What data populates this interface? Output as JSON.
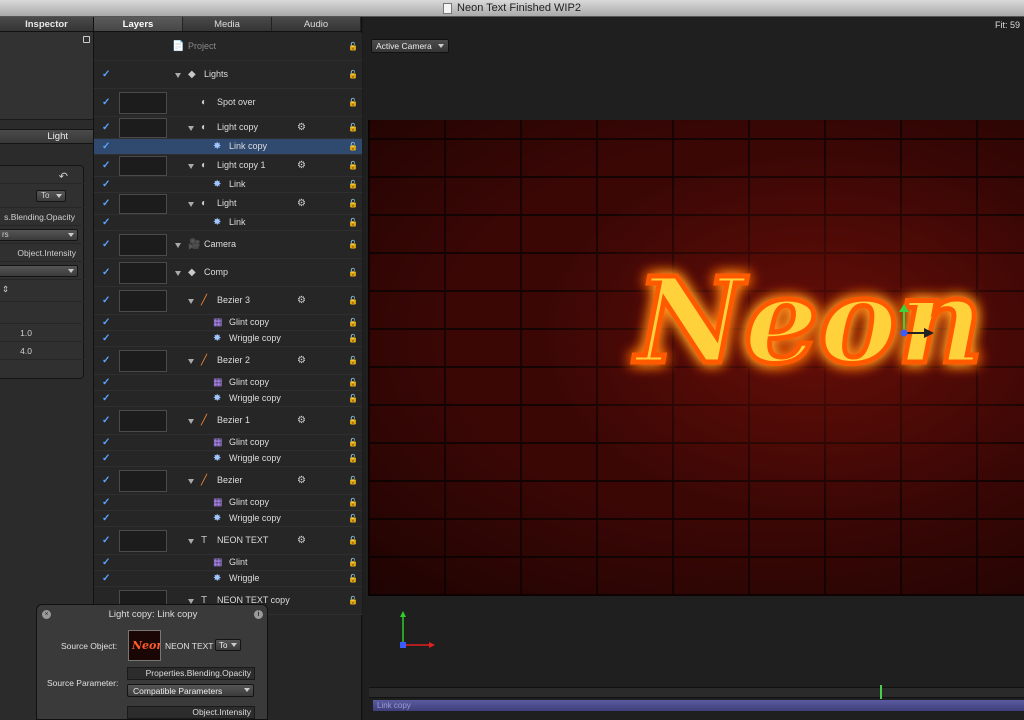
{
  "window": {
    "title": "Neon Text Finished WIP2"
  },
  "inspector": {
    "tab": "Inspector",
    "section_tab": "Light",
    "rows": {
      "to_value": "To",
      "source_parameter": "s.Blending.Opacity",
      "compatible": "rs",
      "target_parameter": "Object.Intensity",
      "stepper": "⇕",
      "val1": "1.0",
      "val2": "4.0"
    }
  },
  "layers_panel": {
    "tabs": [
      "Layers",
      "Media",
      "Audio"
    ],
    "rows": [
      {
        "label": "Project",
        "icon": "📄",
        "checked": false,
        "thumb": false,
        "indent": 94
      },
      {
        "label": "Lights",
        "icon": "◆",
        "checked": true,
        "thumb": false,
        "indent": 110
      },
      {
        "label": "Spot over",
        "icon": "◐",
        "checked": true,
        "thumb": true,
        "indent": 123
      },
      {
        "label": "Light copy",
        "icon": "◐",
        "checked": true,
        "thumb": true,
        "indent": 123
      },
      {
        "label": "Link copy",
        "icon": "✸",
        "checked": true,
        "thumb": false,
        "indent": 135
      },
      {
        "label": "Light copy 1",
        "icon": "◐",
        "checked": true,
        "thumb": true,
        "indent": 123
      },
      {
        "label": "Link",
        "icon": "✸",
        "checked": true,
        "thumb": false,
        "indent": 135
      },
      {
        "label": "Light",
        "icon": "◐",
        "checked": true,
        "thumb": true,
        "indent": 123
      },
      {
        "label": "Link",
        "icon": "✸",
        "checked": true,
        "thumb": false,
        "indent": 135
      },
      {
        "label": "Camera",
        "icon": "🎥",
        "checked": true,
        "thumb": true,
        "indent": 110
      },
      {
        "label": "Comp",
        "icon": "◆",
        "checked": true,
        "thumb": true,
        "indent": 110
      },
      {
        "label": "Bezier 3",
        "icon": "╱",
        "checked": true,
        "thumb": true,
        "indent": 123
      },
      {
        "label": "Glint copy",
        "icon": "▦",
        "checked": true,
        "thumb": false,
        "indent": 135
      },
      {
        "label": "Wriggle copy",
        "icon": "✸",
        "checked": true,
        "thumb": false,
        "indent": 135
      },
      {
        "label": "Bezier 2",
        "icon": "╱",
        "checked": true,
        "thumb": true,
        "indent": 123
      },
      {
        "label": "Glint copy",
        "icon": "▦",
        "checked": true,
        "thumb": false,
        "indent": 135
      },
      {
        "label": "Wriggle copy",
        "icon": "✸",
        "checked": true,
        "thumb": false,
        "indent": 135
      },
      {
        "label": "Bezier 1",
        "icon": "╱",
        "checked": true,
        "thumb": true,
        "indent": 123
      },
      {
        "label": "Glint copy",
        "icon": "▦",
        "checked": true,
        "thumb": false,
        "indent": 135
      },
      {
        "label": "Wriggle copy",
        "icon": "✸",
        "checked": true,
        "thumb": false,
        "indent": 135
      },
      {
        "label": "Bezier",
        "icon": "╱",
        "checked": true,
        "thumb": true,
        "indent": 123
      },
      {
        "label": "Glint copy",
        "icon": "▦",
        "checked": true,
        "thumb": false,
        "indent": 135
      },
      {
        "label": "Wriggle copy",
        "icon": "✸",
        "checked": true,
        "thumb": false,
        "indent": 135
      },
      {
        "label": "NEON TEXT",
        "icon": "T",
        "checked": true,
        "thumb": true,
        "indent": 123
      },
      {
        "label": "Glint",
        "icon": "▦",
        "checked": true,
        "thumb": false,
        "indent": 135
      },
      {
        "label": "Wriggle",
        "icon": "✸",
        "checked": true,
        "thumb": false,
        "indent": 135
      },
      {
        "label": "NEON TEXT copy",
        "icon": "T",
        "checked": false,
        "thumb": true,
        "indent": 123
      }
    ]
  },
  "canvas": {
    "fit_label": "Fit: 59",
    "camera_menu": "Active Camera",
    "neon_text": "Neon",
    "clip_label": "Link copy"
  },
  "hud": {
    "title": "Light copy: Link copy",
    "source_object_label": "Source Object:",
    "source_object_value": "NEON TEXT",
    "to_value": "To",
    "source_parameter_label": "Source Parameter:",
    "source_parameter_value": "Properties.Blending.Opacity",
    "compatible_menu": "Compatible Parameters",
    "target_value": "Object.Intensity",
    "thumb_text": "Neon"
  }
}
